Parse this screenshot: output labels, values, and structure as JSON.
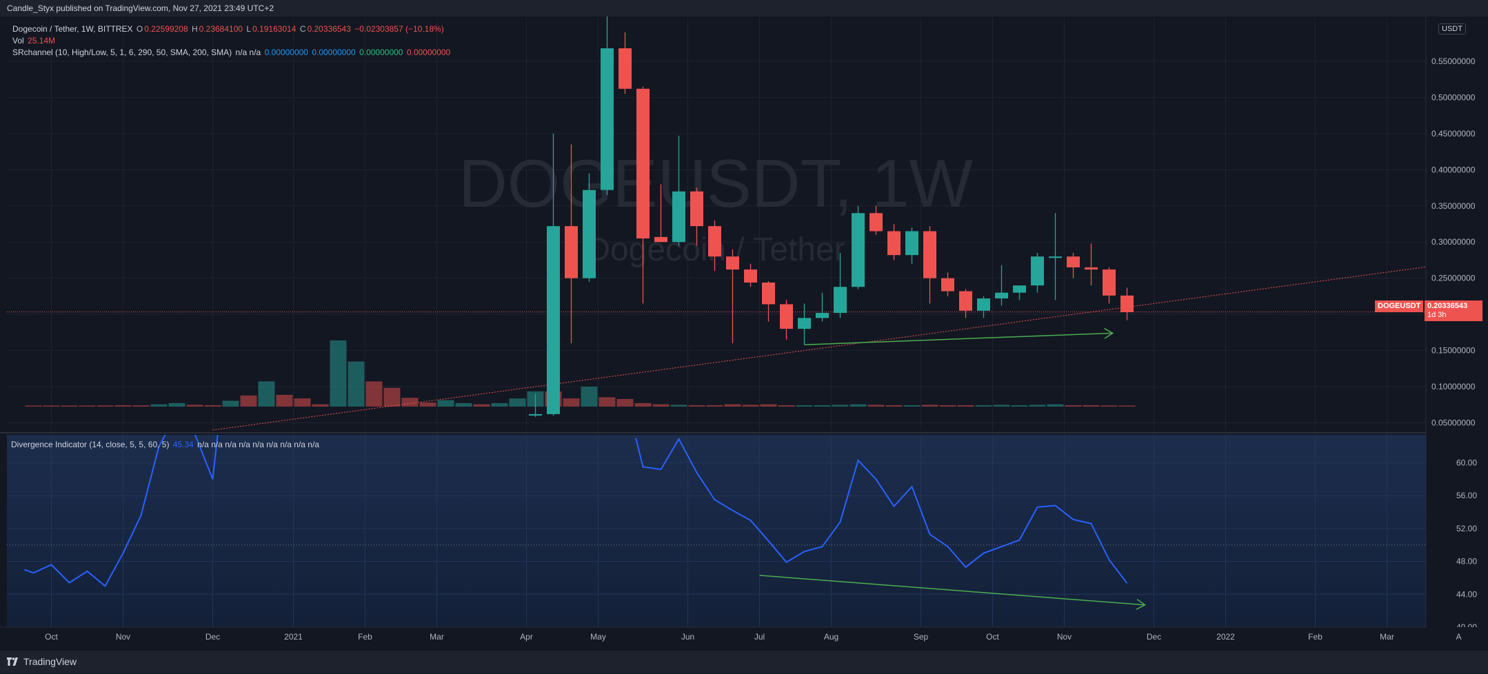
{
  "header": {
    "published_text": "Candle_Styx published on TradingView.com, Nov 27, 2021 23:49 UTC+2"
  },
  "legend": {
    "symbol": "Dogecoin / Tether, 1W, BITTREX",
    "o_label": "O",
    "o_value": "0.22599208",
    "h_label": "H",
    "h_value": "0.23684100",
    "l_label": "L",
    "l_value": "0.19163014",
    "c_label": "C",
    "c_value": "0.20336543",
    "change": "−0.02303857 (−10.18%)",
    "vol_label": "Vol",
    "vol_value": "25.14M",
    "srchannel_label": "SRchannel (10, High/Low, 5, 1, 6, 290, 50, SMA, 200, SMA)",
    "srchannel_na": "n/a  n/a",
    "srchannel_v1": "0.00000000",
    "srchannel_v2": "0.00000000",
    "srchannel_v3": "0.00000000",
    "srchannel_v4": "0.00000000"
  },
  "watermark": {
    "main": "DOGEUSDT, 1W",
    "sub": "Dogecoin / Tether"
  },
  "currency_badge": "USDT",
  "price_tag": {
    "symbol": "DOGEUSDT",
    "price": "0.20336543",
    "countdown": "1d 3h"
  },
  "indicator_legend": {
    "label": "Divergence Indicator (14, close, 5, 5, 60, 5)",
    "value": "45.34",
    "na": "n/a  n/a  n/a  n/a  n/a  n/a  n/a  n/a  n/a"
  },
  "footer": {
    "brand": "TradingView"
  },
  "colors": {
    "background": "#131722",
    "grid": "#1f2330",
    "up": "#26a69a",
    "down": "#ef5350",
    "indicator_line": "#2962ff",
    "annotation": "#4caf50",
    "trendline": "#ef5350"
  },
  "chart_data": [
    {
      "type": "candlestick",
      "title": "Dogecoin / Tether, 1W, BITTREX",
      "y_axis_ticks": [
        0.05,
        0.1,
        0.15,
        0.2,
        0.25,
        0.3,
        0.35,
        0.4,
        0.45,
        0.5,
        0.55
      ],
      "y_axis_tick_labels": [
        "0.05000000",
        "0.10000000",
        "0.15000000",
        "0.20000000",
        "0.25000000",
        "0.30000000",
        "0.35000000",
        "0.40000000",
        "0.45000000",
        "0.50000000",
        "0.55000000"
      ],
      "ylim": [
        0.04,
        0.61
      ],
      "x_axis_labels": [
        {
          "label": "Oct",
          "week": 1
        },
        {
          "label": "Nov",
          "week": 5
        },
        {
          "label": "Dec",
          "week": 10
        },
        {
          "label": "2021",
          "week": 14.5
        },
        {
          "label": "Feb",
          "week": 18.5
        },
        {
          "label": "Mar",
          "week": 22.5
        },
        {
          "label": "Apr",
          "week": 27.5
        },
        {
          "label": "May",
          "week": 31.5
        },
        {
          "label": "Jun",
          "week": 36.5
        },
        {
          "label": "Jul",
          "week": 40.5
        },
        {
          "label": "Aug",
          "week": 44.5
        },
        {
          "label": "Sep",
          "week": 49.5
        },
        {
          "label": "Oct",
          "week": 53.5
        },
        {
          "label": "Nov",
          "week": 57.5
        },
        {
          "label": "Dec",
          "week": 62.5
        },
        {
          "label": "2022",
          "week": 66.5
        },
        {
          "label": "Feb",
          "week": 71.5
        },
        {
          "label": "Mar",
          "week": 75.5
        },
        {
          "label": "A",
          "week": 79.5
        }
      ],
      "candles": [
        {
          "w": 28,
          "o": 0.06,
          "h": 0.09,
          "l": 0.058,
          "c": 0.062
        },
        {
          "w": 29,
          "o": 0.062,
          "h": 0.45,
          "l": 0.06,
          "c": 0.322
        },
        {
          "w": 30,
          "o": 0.322,
          "h": 0.435,
          "l": 0.16,
          "c": 0.25
        },
        {
          "w": 31,
          "o": 0.25,
          "h": 0.395,
          "l": 0.245,
          "c": 0.372
        },
        {
          "w": 32,
          "o": 0.372,
          "h": 0.62,
          "l": 0.365,
          "c": 0.568
        },
        {
          "w": 33,
          "o": 0.568,
          "h": 0.59,
          "l": 0.505,
          "c": 0.512
        },
        {
          "w": 34,
          "o": 0.512,
          "h": 0.515,
          "l": 0.215,
          "c": 0.305
        },
        {
          "w": 35,
          "o": 0.307,
          "h": 0.38,
          "l": 0.3,
          "c": 0.3
        },
        {
          "w": 36,
          "o": 0.3,
          "h": 0.447,
          "l": 0.295,
          "c": 0.37
        },
        {
          "w": 37,
          "o": 0.37,
          "h": 0.375,
          "l": 0.295,
          "c": 0.322
        },
        {
          "w": 38,
          "o": 0.322,
          "h": 0.33,
          "l": 0.26,
          "c": 0.28
        },
        {
          "w": 39,
          "o": 0.28,
          "h": 0.29,
          "l": 0.16,
          "c": 0.262
        },
        {
          "w": 40,
          "o": 0.262,
          "h": 0.27,
          "l": 0.238,
          "c": 0.244
        },
        {
          "w": 41,
          "o": 0.244,
          "h": 0.246,
          "l": 0.19,
          "c": 0.214
        },
        {
          "w": 42,
          "o": 0.214,
          "h": 0.22,
          "l": 0.165,
          "c": 0.18
        },
        {
          "w": 43,
          "o": 0.18,
          "h": 0.215,
          "l": 0.158,
          "c": 0.195
        },
        {
          "w": 44,
          "o": 0.195,
          "h": 0.23,
          "l": 0.19,
          "c": 0.202
        },
        {
          "w": 45,
          "o": 0.202,
          "h": 0.285,
          "l": 0.195,
          "c": 0.238
        },
        {
          "w": 46,
          "o": 0.238,
          "h": 0.35,
          "l": 0.235,
          "c": 0.34
        },
        {
          "w": 47,
          "o": 0.34,
          "h": 0.35,
          "l": 0.31,
          "c": 0.315
        },
        {
          "w": 48,
          "o": 0.315,
          "h": 0.325,
          "l": 0.275,
          "c": 0.282
        },
        {
          "w": 49,
          "o": 0.282,
          "h": 0.32,
          "l": 0.27,
          "c": 0.315
        },
        {
          "w": 50,
          "o": 0.315,
          "h": 0.322,
          "l": 0.215,
          "c": 0.25
        },
        {
          "w": 51,
          "o": 0.25,
          "h": 0.258,
          "l": 0.225,
          "c": 0.232
        },
        {
          "w": 52,
          "o": 0.232,
          "h": 0.235,
          "l": 0.195,
          "c": 0.205
        },
        {
          "w": 53,
          "o": 0.205,
          "h": 0.225,
          "l": 0.195,
          "c": 0.222
        },
        {
          "w": 54,
          "o": 0.222,
          "h": 0.268,
          "l": 0.212,
          "c": 0.23
        },
        {
          "w": 55,
          "o": 0.23,
          "h": 0.24,
          "l": 0.22,
          "c": 0.24
        },
        {
          "w": 56,
          "o": 0.24,
          "h": 0.285,
          "l": 0.23,
          "c": 0.28
        },
        {
          "w": 57,
          "o": 0.278,
          "h": 0.34,
          "l": 0.22,
          "c": 0.28
        },
        {
          "w": 58,
          "o": 0.28,
          "h": 0.285,
          "l": 0.25,
          "c": 0.265
        },
        {
          "w": 59,
          "o": 0.265,
          "h": 0.298,
          "l": 0.24,
          "c": 0.262
        },
        {
          "w": 60,
          "o": 0.262,
          "h": 0.265,
          "l": 0.215,
          "c": 0.226
        },
        {
          "w": 61,
          "o": 0.226,
          "h": 0.237,
          "l": 0.192,
          "c": 0.203
        }
      ],
      "volume": {
        "max_value_M": 2000,
        "bars": [
          {
            "w": 0,
            "v": 18,
            "up": false
          },
          {
            "w": 1,
            "v": 14,
            "up": false
          },
          {
            "w": 2,
            "v": 16,
            "up": false
          },
          {
            "w": 3,
            "v": 18,
            "up": false
          },
          {
            "w": 4,
            "v": 20,
            "up": false
          },
          {
            "w": 5,
            "v": 24,
            "up": false
          },
          {
            "w": 6,
            "v": 22,
            "up": false
          },
          {
            "w": 7,
            "v": 40,
            "up": true
          },
          {
            "w": 8,
            "v": 60,
            "up": true
          },
          {
            "w": 9,
            "v": 30,
            "up": false
          },
          {
            "w": 10,
            "v": 24,
            "up": false
          },
          {
            "w": 11,
            "v": 100,
            "up": true
          },
          {
            "w": 12,
            "v": 190,
            "up": false
          },
          {
            "w": 13,
            "v": 430,
            "up": true
          },
          {
            "w": 14,
            "v": 200,
            "up": false
          },
          {
            "w": 15,
            "v": 140,
            "up": false
          },
          {
            "w": 16,
            "v": 40,
            "up": false
          },
          {
            "w": 17,
            "v": 1130,
            "up": true
          },
          {
            "w": 18,
            "v": 770,
            "up": true
          },
          {
            "w": 19,
            "v": 430,
            "up": false
          },
          {
            "w": 20,
            "v": 320,
            "up": false
          },
          {
            "w": 21,
            "v": 150,
            "up": false
          },
          {
            "w": 22,
            "v": 70,
            "up": false
          },
          {
            "w": 23,
            "v": 110,
            "up": true
          },
          {
            "w": 24,
            "v": 60,
            "up": true
          },
          {
            "w": 25,
            "v": 40,
            "up": false
          },
          {
            "w": 26,
            "v": 60,
            "up": true
          },
          {
            "w": 27,
            "v": 140,
            "up": true
          },
          {
            "w": 28,
            "v": 260,
            "up": true
          },
          {
            "w": 29,
            "v": 260,
            "up": false
          },
          {
            "w": 30,
            "v": 140,
            "up": false
          },
          {
            "w": 31,
            "v": 340,
            "up": true
          },
          {
            "w": 32,
            "v": 160,
            "up": false
          },
          {
            "w": 33,
            "v": 130,
            "up": false
          },
          {
            "w": 34,
            "v": 60,
            "up": false
          },
          {
            "w": 35,
            "v": 40,
            "up": false
          },
          {
            "w": 36,
            "v": 30,
            "up": true
          },
          {
            "w": 37,
            "v": 24,
            "up": false
          },
          {
            "w": 38,
            "v": 24,
            "up": false
          },
          {
            "w": 39,
            "v": 40,
            "up": false
          },
          {
            "w": 40,
            "v": 30,
            "up": false
          },
          {
            "w": 41,
            "v": 40,
            "up": false
          },
          {
            "w": 42,
            "v": 24,
            "up": false
          },
          {
            "w": 43,
            "v": 24,
            "up": true
          },
          {
            "w": 44,
            "v": 24,
            "up": true
          },
          {
            "w": 45,
            "v": 30,
            "up": true
          },
          {
            "w": 46,
            "v": 40,
            "up": true
          },
          {
            "w": 47,
            "v": 30,
            "up": false
          },
          {
            "w": 48,
            "v": 24,
            "up": false
          },
          {
            "w": 49,
            "v": 24,
            "up": true
          },
          {
            "w": 50,
            "v": 30,
            "up": false
          },
          {
            "w": 51,
            "v": 24,
            "up": false
          },
          {
            "w": 52,
            "v": 24,
            "up": false
          },
          {
            "w": 53,
            "v": 24,
            "up": true
          },
          {
            "w": 54,
            "v": 30,
            "up": true
          },
          {
            "w": 55,
            "v": 24,
            "up": true
          },
          {
            "w": 56,
            "v": 30,
            "up": true
          },
          {
            "w": 57,
            "v": 40,
            "up": true
          },
          {
            "w": 58,
            "v": 24,
            "up": false
          },
          {
            "w": 59,
            "v": 24,
            "up": false
          },
          {
            "w": 60,
            "v": 20,
            "up": false
          },
          {
            "w": 61,
            "v": 18,
            "up": false
          }
        ]
      },
      "horizontal_line": {
        "price": 0.20336543
      },
      "trendline": {
        "w1": 10,
        "p1": 0.04,
        "w2": 79.6,
        "p2": 0.272
      },
      "annotation_arrow": {
        "w1": 43,
        "p1": 0.158,
        "w2": 60.2,
        "p2": 0.174
      }
    },
    {
      "type": "line",
      "title": "Divergence Indicator (14, close, 5, 5, 60, 5)",
      "ylim": [
        40,
        63.4
      ],
      "y_axis_ticks": [
        40,
        44,
        48,
        52,
        56,
        60
      ],
      "y_axis_tick_labels": [
        "40.00",
        "44.00",
        "48.00",
        "52.00",
        "56.00",
        "60.00"
      ],
      "series": [
        {
          "values": [
            {
              "w": -0.5,
              "v": 47.0
            },
            {
              "w": 0,
              "v": 46.6
            },
            {
              "w": 1,
              "v": 47.6
            },
            {
              "w": 2,
              "v": 45.4
            },
            {
              "w": 3,
              "v": 46.8
            },
            {
              "w": 4,
              "v": 45.0
            },
            {
              "w": 5,
              "v": 49.0
            },
            {
              "w": 6,
              "v": 53.6
            },
            {
              "w": 7,
              "v": 62.0
            },
            {
              "w": 8,
              "v": 66.0
            },
            {
              "w": 9,
              "v": 63.5
            },
            {
              "w": 10,
              "v": 58.0
            },
            {
              "w": 10.3,
              "v": 64.0
            },
            {
              "w": 33.6,
              "v": 63.0
            },
            {
              "w": 34,
              "v": 59.5
            },
            {
              "w": 35,
              "v": 59.2
            },
            {
              "w": 36,
              "v": 62.9
            },
            {
              "w": 37,
              "v": 58.8
            },
            {
              "w": 38,
              "v": 55.5
            },
            {
              "w": 39,
              "v": 54.2
            },
            {
              "w": 40,
              "v": 53.0
            },
            {
              "w": 41,
              "v": 50.5
            },
            {
              "w": 42,
              "v": 47.9
            },
            {
              "w": 43,
              "v": 49.2
            },
            {
              "w": 44,
              "v": 49.8
            },
            {
              "w": 45,
              "v": 52.8
            },
            {
              "w": 46,
              "v": 60.3
            },
            {
              "w": 47,
              "v": 58.0
            },
            {
              "w": 48,
              "v": 54.7
            },
            {
              "w": 49,
              "v": 57.1
            },
            {
              "w": 50,
              "v": 51.3
            },
            {
              "w": 51,
              "v": 49.8
            },
            {
              "w": 52,
              "v": 47.3
            },
            {
              "w": 53,
              "v": 49.0
            },
            {
              "w": 54,
              "v": 49.8
            },
            {
              "w": 55,
              "v": 50.6
            },
            {
              "w": 56,
              "v": 54.6
            },
            {
              "w": 57,
              "v": 54.8
            },
            {
              "w": 58,
              "v": 53.1
            },
            {
              "w": 59,
              "v": 52.6
            },
            {
              "w": 60,
              "v": 48.2
            },
            {
              "w": 61,
              "v": 45.34
            }
          ]
        }
      ],
      "reference_line": 50,
      "annotation_arrow": {
        "w1": 40.5,
        "v1": 46.3,
        "w2": 62,
        "v2": 42.7
      }
    }
  ]
}
